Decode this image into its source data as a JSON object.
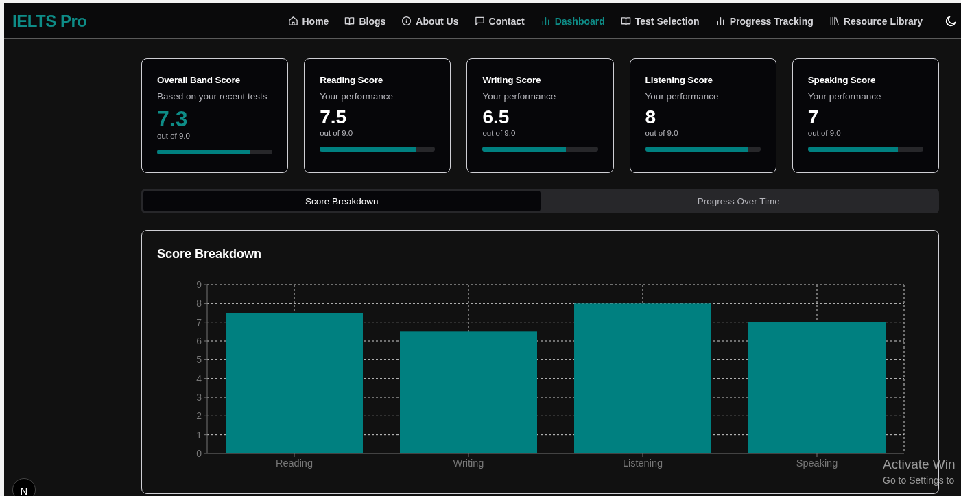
{
  "nav": {
    "logo": "IELTS Pro",
    "items": [
      {
        "label": "Home",
        "selected": false
      },
      {
        "label": "Blogs",
        "selected": false
      },
      {
        "label": "About Us",
        "selected": false
      },
      {
        "label": "Contact",
        "selected": false
      },
      {
        "label": "Dashboard",
        "selected": true
      },
      {
        "label": "Test Selection",
        "selected": false
      },
      {
        "label": "Progress Tracking",
        "selected": false
      },
      {
        "label": "Resource Library",
        "selected": false
      }
    ]
  },
  "score_cards": [
    {
      "title": "Overall Band Score",
      "subtitle": "Based on your recent tests",
      "score": "7.3",
      "highlight": true,
      "note": "out of 9.0",
      "level": 0.81
    },
    {
      "title": "Reading Score",
      "subtitle": "Your performance",
      "score": "7.5",
      "highlight": false,
      "note": "out of 9.0",
      "level": 0.833
    },
    {
      "title": "Writing Score",
      "subtitle": "Your performance",
      "score": "6.5",
      "highlight": false,
      "note": "out of 9.0",
      "level": 0.722
    },
    {
      "title": "Listening Score",
      "subtitle": "Your performance",
      "score": "8",
      "highlight": false,
      "note": "out of 9.0",
      "level": 0.889
    },
    {
      "title": "Speaking Score",
      "subtitle": "Your performance",
      "score": "7",
      "highlight": false,
      "note": "out of 9.0",
      "level": 0.778
    }
  ],
  "tabs": [
    {
      "label": "Score Breakdown",
      "selected": true
    },
    {
      "label": "Progress Over Time",
      "selected": false
    }
  ],
  "breakdown": {
    "title": "Score Breakdown",
    "chart_data": {
      "type": "bar",
      "categories": [
        "Reading",
        "Writing",
        "Listening",
        "Speaking"
      ],
      "series": [
        {
          "color": "#008080",
          "values": [
            7.5,
            6.5,
            8,
            7
          ]
        }
      ],
      "ylim": [
        0,
        9
      ],
      "grid": true,
      "yticks": [
        0,
        1,
        2,
        3,
        4,
        5,
        6,
        7,
        8,
        9
      ]
    }
  },
  "dev_badge": "N",
  "os_notice": {
    "title": "Activate Win",
    "text": "Go to Settings to"
  }
}
